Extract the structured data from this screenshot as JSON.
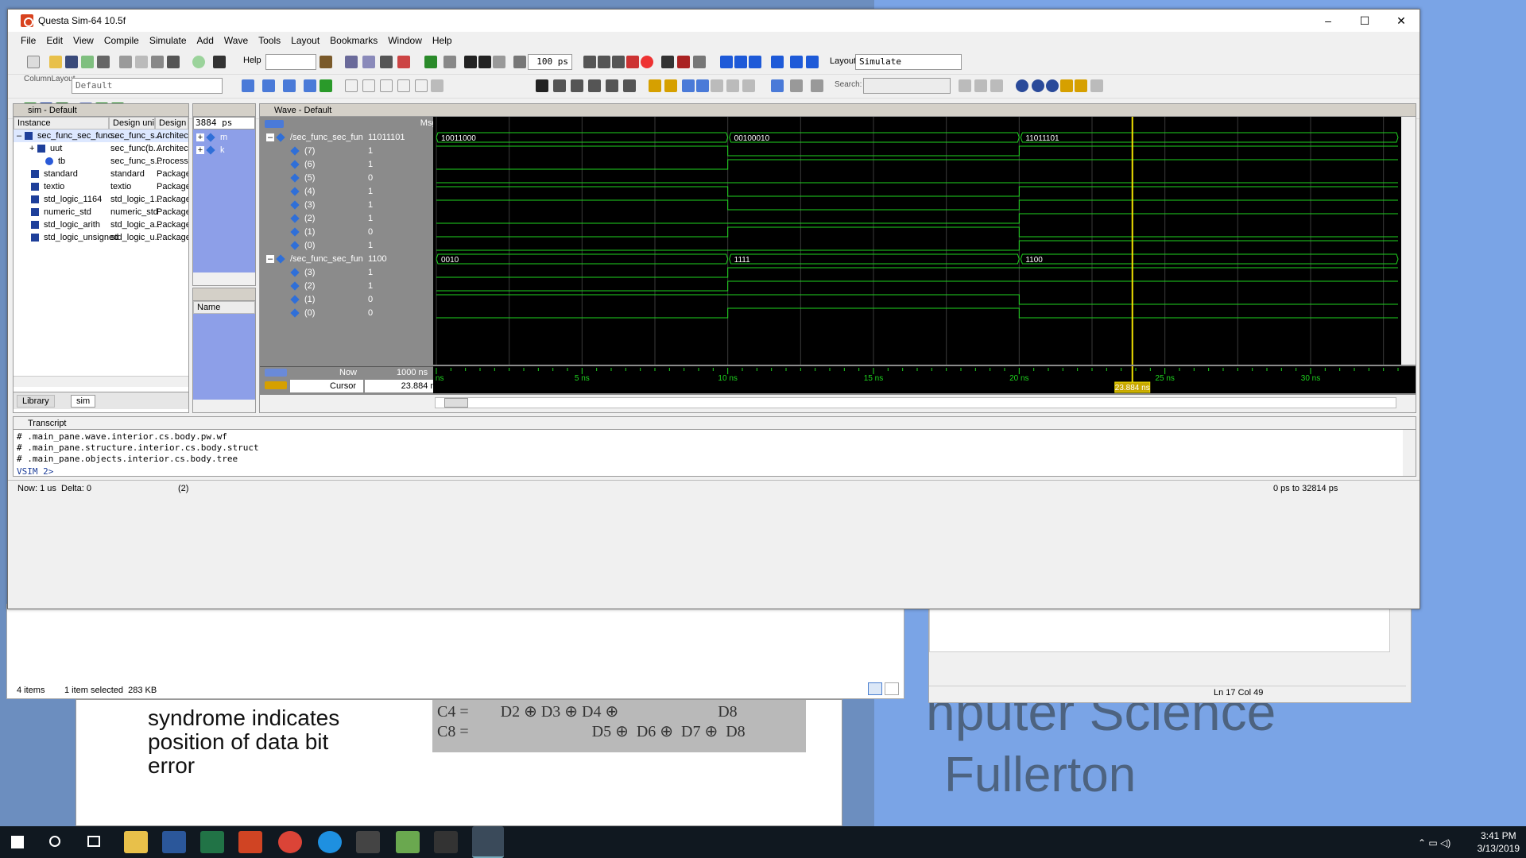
{
  "questa": {
    "title": "Questa Sim-64 10.5f",
    "win_min": "–",
    "win_max": "☐",
    "win_close": "✕",
    "menu": [
      "File",
      "Edit",
      "View",
      "Compile",
      "Simulate",
      "Add",
      "Wave",
      "Tools",
      "Layout",
      "Bookmarks",
      "Window",
      "Help"
    ],
    "toolbar": {
      "help_label": "Help",
      "run_length": "100 ps",
      "layout_label": "Layout",
      "layout_value": "Simulate",
      "columnlayout_label": "ColumnLayout",
      "columnlayout_value": "Default",
      "search_label": "Search:"
    }
  },
  "sim_panel": {
    "title": "sim - Default",
    "columns": [
      "Instance",
      "Design unit",
      "Design ur"
    ],
    "rows": [
      {
        "instance": "sec_func_sec_func...",
        "unit": "sec_func_s...",
        "type": "Architect"
      },
      {
        "instance": "uut",
        "unit": "sec_func(b...",
        "type": "Architect"
      },
      {
        "instance": "tb",
        "unit": "sec_func_s...",
        "type": "Process"
      },
      {
        "instance": "standard",
        "unit": "standard",
        "type": "Package"
      },
      {
        "instance": "textio",
        "unit": "textio",
        "type": "Package"
      },
      {
        "instance": "std_logic_1164",
        "unit": "std_logic_1...",
        "type": "Package"
      },
      {
        "instance": "numeric_std",
        "unit": "numeric_std",
        "type": "Package"
      },
      {
        "instance": "std_logic_arith",
        "unit": "std_logic_a...",
        "type": "Package"
      },
      {
        "instance": "std_logic_unsigned",
        "unit": "std_logic_u...",
        "type": "Package"
      }
    ],
    "tabs": [
      "Library",
      "sim"
    ]
  },
  "objects_panel": {
    "time": "3884 ps",
    "items": [
      "m",
      "k"
    ],
    "lower_header": "Name"
  },
  "wave": {
    "title": "Wave - Default",
    "msgs_label": "Msgs",
    "signals": [
      {
        "name": "/sec_func_sec_func...",
        "value": "11011101",
        "kind": "bus"
      },
      {
        "name": "(7)",
        "value": "1",
        "kind": "bit"
      },
      {
        "name": "(6)",
        "value": "1",
        "kind": "bit"
      },
      {
        "name": "(5)",
        "value": "0",
        "kind": "bit"
      },
      {
        "name": "(4)",
        "value": "1",
        "kind": "bit"
      },
      {
        "name": "(3)",
        "value": "1",
        "kind": "bit"
      },
      {
        "name": "(2)",
        "value": "1",
        "kind": "bit"
      },
      {
        "name": "(1)",
        "value": "0",
        "kind": "bit"
      },
      {
        "name": "(0)",
        "value": "1",
        "kind": "bit"
      },
      {
        "name": "/sec_func_sec_func...",
        "value": "1100",
        "kind": "bus"
      },
      {
        "name": "(3)",
        "value": "1",
        "kind": "bit"
      },
      {
        "name": "(2)",
        "value": "1",
        "kind": "bit"
      },
      {
        "name": "(1)",
        "value": "0",
        "kind": "bit"
      },
      {
        "name": "(0)",
        "value": "0",
        "kind": "bit"
      }
    ],
    "bus_segments": [
      [
        "10011000",
        "00100010",
        "11011101"
      ],
      [
        "0010",
        "1111",
        "1100"
      ]
    ],
    "bit_levels": [
      [
        1,
        0,
        1
      ],
      [
        0,
        1,
        1
      ],
      [
        0,
        0,
        0
      ],
      [
        1,
        0,
        1
      ],
      [
        1,
        0,
        1
      ],
      [
        0,
        0,
        1
      ],
      [
        0,
        1,
        0
      ],
      [
        0,
        0,
        1
      ],
      [
        0,
        1,
        1
      ],
      [
        0,
        1,
        1
      ],
      [
        1,
        1,
        0
      ],
      [
        0,
        1,
        0
      ]
    ],
    "transition_times_ns": [
      10,
      20
    ],
    "time_range_ns": [
      0,
      33
    ],
    "cursor_ns": 23.884,
    "now_label": "Now",
    "now_value": "1000 ns",
    "cursor_label": "Cursor 1",
    "cursor_value": "23.884 ns",
    "cursor_tag": "23.884 ns",
    "ticks": [
      {
        "t": 0,
        "label": "0 ns"
      },
      {
        "t": 5,
        "label": "5 ns"
      },
      {
        "t": 10,
        "label": "10 ns"
      },
      {
        "t": 15,
        "label": "15 ns"
      },
      {
        "t": 20,
        "label": "20 ns"
      },
      {
        "t": 25,
        "label": "25 ns"
      },
      {
        "t": 30,
        "label": "30 ns"
      }
    ]
  },
  "transcript": {
    "title": "Transcript",
    "lines": [
      "# .main_pane.wave.interior.cs.body.pw.wf",
      "# .main_pane.structure.interior.cs.body.struct",
      "# .main_pane.objects.interior.cs.body.tree"
    ],
    "prompt": "VSIM 2>"
  },
  "status": {
    "now": "Now: 1 us  Delta: 0",
    "middle": "(2)",
    "range": "0 ps to 32814 ps"
  },
  "explorer": {
    "items": "4 items",
    "selected": "1 item selected  283 KB"
  },
  "notepad": {
    "position": "Ln 17 Col 49"
  },
  "background": {
    "doc_text": [
      "syndrome indicates",
      "position of data bit",
      "error"
    ],
    "eq1": "C4 =        D2 ⊕ D3 ⊕ D4 ⊕                         D8",
    "eq2": "C8 =                               D5 ⊕  D6 ⊕  D7 ⊕  D8",
    "title1": "nputer Science",
    "title2": "Fullerton"
  },
  "taskbar": {
    "time": "3:41 PM",
    "date": "3/13/2019"
  },
  "colors": {
    "wave_green": "#1fd41f",
    "cursor_yellow": "#f2e200",
    "accent": "#1e3f9a"
  }
}
